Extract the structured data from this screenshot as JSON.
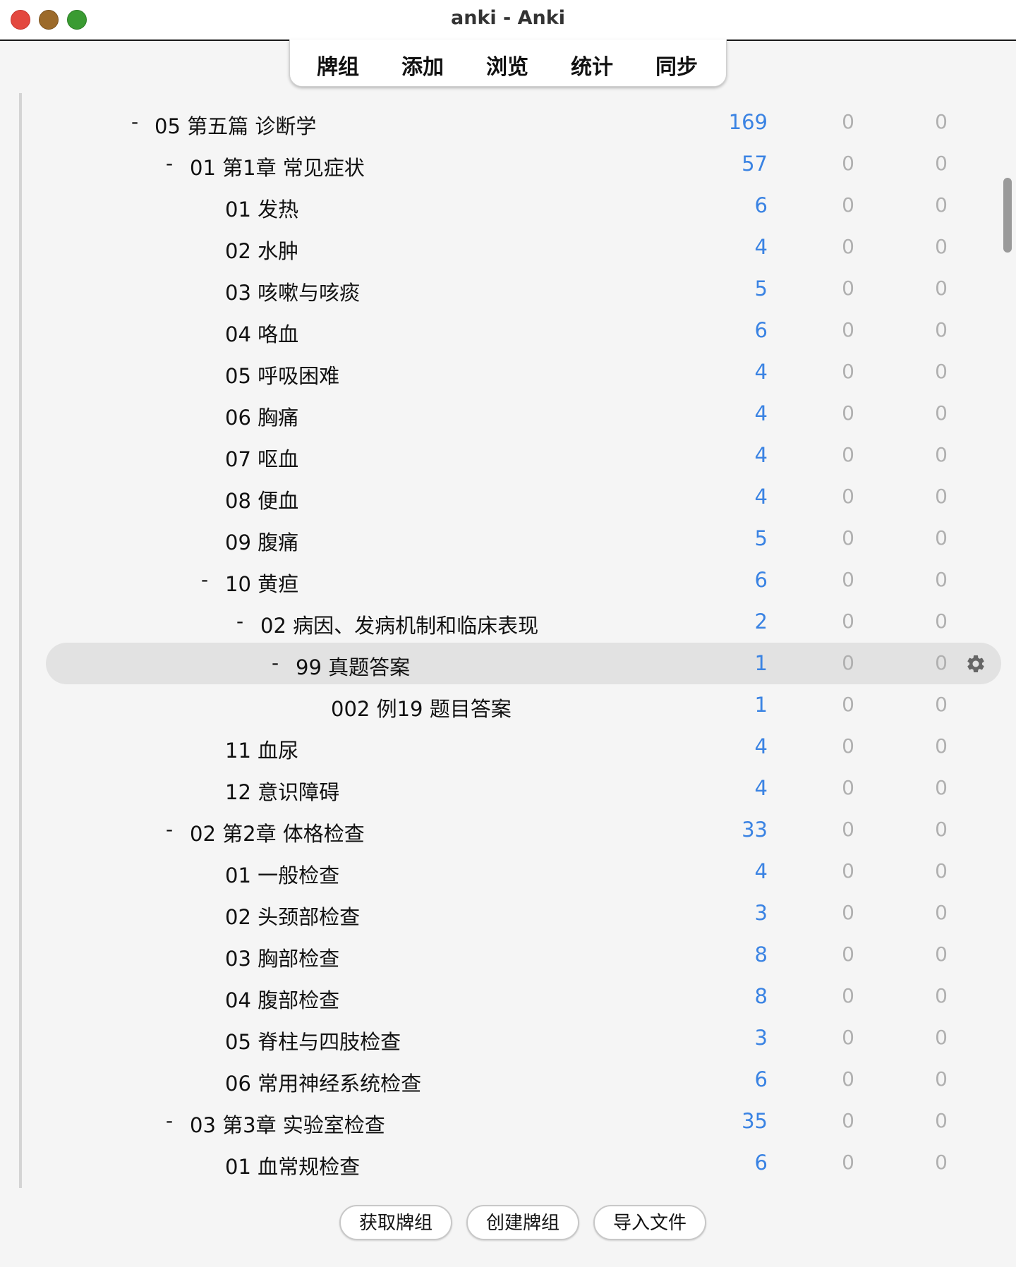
{
  "window": {
    "title": "anki - Anki"
  },
  "toolbar": {
    "decks": "牌组",
    "add": "添加",
    "browse": "浏览",
    "stats": "统计",
    "sync": "同步"
  },
  "decks": [
    {
      "collapse": "-",
      "name": "05 第五篇 诊断学",
      "new": "169",
      "learn": "0",
      "due": "0"
    },
    {
      "collapse": "-",
      "name": "01 第1章 常见症状",
      "new": "57",
      "learn": "0",
      "due": "0"
    },
    {
      "collapse": "",
      "name": "01 发热",
      "new": "6",
      "learn": "0",
      "due": "0"
    },
    {
      "collapse": "",
      "name": "02 水肿",
      "new": "4",
      "learn": "0",
      "due": "0"
    },
    {
      "collapse": "",
      "name": "03 咳嗽与咳痰",
      "new": "5",
      "learn": "0",
      "due": "0"
    },
    {
      "collapse": "",
      "name": "04 咯血",
      "new": "6",
      "learn": "0",
      "due": "0"
    },
    {
      "collapse": "",
      "name": "05 呼吸困难",
      "new": "4",
      "learn": "0",
      "due": "0"
    },
    {
      "collapse": "",
      "name": "06 胸痛",
      "new": "4",
      "learn": "0",
      "due": "0"
    },
    {
      "collapse": "",
      "name": "07 呕血",
      "new": "4",
      "learn": "0",
      "due": "0"
    },
    {
      "collapse": "",
      "name": "08 便血",
      "new": "4",
      "learn": "0",
      "due": "0"
    },
    {
      "collapse": "",
      "name": "09 腹痛",
      "new": "5",
      "learn": "0",
      "due": "0"
    },
    {
      "collapse": "-",
      "name": "10 黄疸",
      "new": "6",
      "learn": "0",
      "due": "0"
    },
    {
      "collapse": "-",
      "name": "02 病因、发病机制和临床表现",
      "new": "2",
      "learn": "0",
      "due": "0"
    },
    {
      "collapse": "-",
      "name": "99 真题答案",
      "new": "1",
      "learn": "0",
      "due": "0"
    },
    {
      "collapse": "",
      "name": "002 例19 题目答案",
      "new": "1",
      "learn": "0",
      "due": "0"
    },
    {
      "collapse": "",
      "name": "11 血尿",
      "new": "4",
      "learn": "0",
      "due": "0"
    },
    {
      "collapse": "",
      "name": "12 意识障碍",
      "new": "4",
      "learn": "0",
      "due": "0"
    },
    {
      "collapse": "-",
      "name": "02 第2章 体格检查",
      "new": "33",
      "learn": "0",
      "due": "0"
    },
    {
      "collapse": "",
      "name": "01 一般检查",
      "new": "4",
      "learn": "0",
      "due": "0"
    },
    {
      "collapse": "",
      "name": "02 头颈部检查",
      "new": "3",
      "learn": "0",
      "due": "0"
    },
    {
      "collapse": "",
      "name": "03 胸部检查",
      "new": "8",
      "learn": "0",
      "due": "0"
    },
    {
      "collapse": "",
      "name": "04 腹部检查",
      "new": "8",
      "learn": "0",
      "due": "0"
    },
    {
      "collapse": "",
      "name": "05 脊柱与四肢检查",
      "new": "3",
      "learn": "0",
      "due": "0"
    },
    {
      "collapse": "",
      "name": "06 常用神经系统检查",
      "new": "6",
      "learn": "0",
      "due": "0"
    },
    {
      "collapse": "-",
      "name": "03 第3章 实验室检查",
      "new": "35",
      "learn": "0",
      "due": "0"
    },
    {
      "collapse": "",
      "name": "01 血常规检查",
      "new": "6",
      "learn": "0",
      "due": "0"
    }
  ],
  "bottom": {
    "get_shared": "获取牌组",
    "create_deck": "创建牌组",
    "import_file": "导入文件"
  },
  "colors": {
    "new_count": "#3a83e3",
    "zero_count": "#b0b0b0",
    "selected_row": "#e2e2e2"
  },
  "icons": {
    "options": "gear-icon"
  }
}
